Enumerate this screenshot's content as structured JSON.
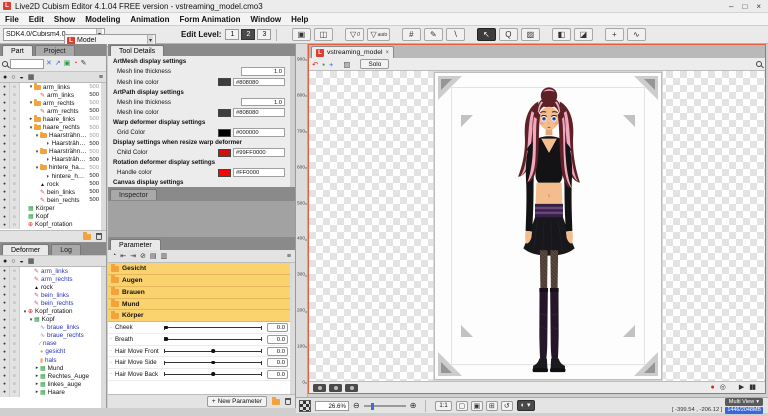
{
  "theme": {
    "accent-orange": "#e2613c",
    "folder-orange": "#f2a33c",
    "param-yellow": "#fad36e",
    "link-blue": "#2233bb",
    "hair-dark": "#5d2127",
    "hair-pink": "#f0a8bd",
    "skin": "#f3bd8d",
    "outfit": "#131315",
    "boot": "#251729",
    "eye-blue": "#3a66cc"
  },
  "icons": {
    "minimize": "–",
    "maximize": "□",
    "close": "×",
    "dropdown": "▾",
    "eye": "●",
    "lock": "○",
    "ghost": "◒",
    "grid": "▦",
    "menu": "≡",
    "tab-close": "×",
    "caret": "▾",
    "mag-minus": "⊖",
    "mag-plus": "⊕",
    "rotate": "↺",
    "grid-btn": "⊞",
    "display": "◐",
    "record": "●",
    "stop": "◎",
    "play": "▶",
    "pause": "▮▮",
    "new-param-plus": "+"
  },
  "title_bar": {
    "title": "Live2D Cubism Editor 4.1.04   FREE version - vstreaming_model.cmo3"
  },
  "menu_bar": {
    "items": [
      {
        "label": "File",
        "enabled": true
      },
      {
        "label": "Edit",
        "enabled": true
      },
      {
        "label": "Show",
        "enabled": true
      },
      {
        "label": "Modeling",
        "enabled": true
      },
      {
        "label": "Animation",
        "enabled": false
      },
      {
        "label": "Form Animation",
        "enabled": false
      },
      {
        "label": "Window",
        "enabled": true
      },
      {
        "label": "Help",
        "enabled": true
      }
    ]
  },
  "toolbar": {
    "sdk_value": "SDK4.0/Cubism4.0",
    "mode_value": "Model",
    "edit_level_label": "Edit Level:",
    "edit_levels": [
      {
        "label": "1",
        "active": false
      },
      {
        "label": "2",
        "active": true
      },
      {
        "label": "3",
        "active": false
      }
    ],
    "tool_buttons": [
      {
        "glyph": "▣"
      },
      {
        "glyph": "◫"
      },
      {
        "glyph": "▽",
        "sub": "0",
        "gap": true
      },
      {
        "glyph": "▽",
        "sub": "auto"
      },
      {
        "glyph": "#",
        "gap": true
      },
      {
        "glyph": "✎"
      },
      {
        "glyph": "∖"
      },
      {
        "glyph": "↖",
        "sel": true,
        "gap": true
      },
      {
        "glyph": "Q"
      },
      {
        "glyph": "▨"
      },
      {
        "glyph": "◧",
        "gap": true
      },
      {
        "glyph": "◪"
      },
      {
        "glyph": "+",
        "gap": true
      },
      {
        "glyph": "∿"
      }
    ]
  },
  "part_panel": {
    "tabs": [
      {
        "label": "Part",
        "active": true
      },
      {
        "label": "Project",
        "active": false
      }
    ],
    "quick_icons": [
      {
        "glyph": "✕",
        "color2": "#3a6fd8"
      },
      {
        "glyph": "↗",
        "color2": "#3a6fd8"
      },
      {
        "glyph": "▣",
        "color2": "#2a9c3f"
      },
      {
        "glyph": "◔",
        "color2": "#cc2222"
      },
      {
        "glyph": "✎",
        "color2": "#333333"
      }
    ],
    "rows": [
      {
        "label": "arm_links",
        "icon": "folder",
        "expand": "open",
        "indent": 1,
        "value": "500",
        "muted": true
      },
      {
        "label": "arm_links",
        "icon": "mesh",
        "expand": "none",
        "indent": 2,
        "value": "500"
      },
      {
        "label": "arm_rechts",
        "icon": "folder",
        "expand": "open",
        "indent": 1,
        "value": "500",
        "muted": true
      },
      {
        "label": "arm_rechts",
        "icon": "mesh",
        "expand": "none",
        "indent": 2,
        "value": "500"
      },
      {
        "label": "haare_links",
        "icon": "folder",
        "expand": "closed",
        "indent": 1,
        "value": "500",
        "muted": true
      },
      {
        "label": "haare_rechts",
        "icon": "folder",
        "expand": "open",
        "indent": 1,
        "value": "500",
        "muted": true
      },
      {
        "label": "Haarsträhne_rechts",
        "icon": "folder",
        "expand": "open",
        "indent": 2,
        "value": "500",
        "muted": true
      },
      {
        "label": "Haarsträhne_rechts",
        "icon": "hair",
        "expand": "none",
        "indent": 3,
        "value": "500"
      },
      {
        "label": "Haarsträhne_rechts",
        "icon": "folder",
        "expand": "open",
        "indent": 2,
        "value": "500",
        "muted": true
      },
      {
        "label": "Haarsträhne_rechts",
        "icon": "hair",
        "expand": "none",
        "indent": 3,
        "value": "500"
      },
      {
        "label": "hintere_haare_rechts",
        "icon": "folder",
        "expand": "open",
        "indent": 2,
        "value": "500",
        "muted": true
      },
      {
        "label": "hintere_haare",
        "icon": "hair",
        "expand": "none",
        "indent": 3,
        "value": "500"
      },
      {
        "label": "rock",
        "icon": "skirt",
        "expand": "none",
        "indent": 2,
        "value": "500"
      },
      {
        "label": "bein_links",
        "icon": "mesh",
        "expand": "none",
        "indent": 2,
        "value": "500"
      },
      {
        "label": "bein_rechts",
        "icon": "mesh",
        "expand": "none",
        "indent": 2,
        "value": "500"
      },
      {
        "label": "Körper",
        "icon": "warp",
        "expand": "none",
        "indent": 0,
        "value": ""
      },
      {
        "label": "Kopf",
        "icon": "warp",
        "expand": "none",
        "indent": 0,
        "value": ""
      },
      {
        "label": "Kopf_rotation",
        "icon": "rot",
        "expand": "none",
        "indent": 0,
        "value": ""
      }
    ]
  },
  "deformer_panel": {
    "tabs": [
      {
        "label": "Deformer",
        "active": true
      },
      {
        "label": "Log",
        "active": false
      }
    ],
    "rows": [
      {
        "label": "arm_links",
        "icon": "mesh",
        "expand": "none",
        "indent": 1,
        "color": "blue"
      },
      {
        "label": "arm_rechts",
        "icon": "mesh",
        "expand": "none",
        "indent": 1,
        "color": "blue"
      },
      {
        "label": "rock",
        "icon": "skirt",
        "expand": "none",
        "indent": 1,
        "color": "black"
      },
      {
        "label": "bein_links",
        "icon": "mesh",
        "expand": "none",
        "indent": 1,
        "color": "blue"
      },
      {
        "label": "bein_rechts",
        "icon": "mesh",
        "expand": "none",
        "indent": 1,
        "color": "blue"
      },
      {
        "label": "Kopf_rotation",
        "icon": "rot",
        "expand": "open",
        "indent": 0,
        "color": "black"
      },
      {
        "label": "Kopf",
        "icon": "warp",
        "expand": "open",
        "indent": 1,
        "color": "black"
      },
      {
        "label": "braue_links",
        "icon": "curve",
        "expand": "none",
        "indent": 2,
        "color": "blue"
      },
      {
        "label": "braue_rechts",
        "icon": "curve",
        "expand": "none",
        "indent": 2,
        "color": "blue"
      },
      {
        "label": "nase",
        "icon": "line",
        "expand": "none",
        "indent": 2,
        "color": "blue"
      },
      {
        "label": "gesicht",
        "icon": "dot-orange",
        "expand": "none",
        "indent": 2,
        "color": "blue"
      },
      {
        "label": "hals",
        "icon": "box-orange",
        "expand": "none",
        "indent": 2,
        "color": "blue"
      },
      {
        "label": "Mund",
        "icon": "warp",
        "expand": "closed",
        "indent": 2,
        "color": "black"
      },
      {
        "label": "Rechtes_Auge",
        "icon": "warp",
        "expand": "closed",
        "indent": 2,
        "color": "black"
      },
      {
        "label": "linkes_auge",
        "icon": "warp",
        "expand": "closed",
        "indent": 2,
        "color": "black"
      },
      {
        "label": "Haare",
        "icon": "warp",
        "expand": "closed",
        "indent": 2,
        "color": "black"
      }
    ]
  },
  "tool_details": {
    "tab": "Tool Details",
    "inspector_tab": "Inspector",
    "rows": [
      {
        "kind": "header",
        "label": "ArtMesh display settings"
      },
      {
        "kind": "field",
        "label": "Mesh line thickness",
        "value": "1.0",
        "input": "number"
      },
      {
        "kind": "field",
        "label": "Mesh line color",
        "value": "#808080",
        "swatch": "#3d3d3d",
        "input": "color"
      },
      {
        "kind": "header",
        "label": "ArtPath display settings"
      },
      {
        "kind": "field",
        "label": "Mesh line thickness",
        "value": "1.0",
        "input": "number"
      },
      {
        "kind": "field",
        "label": "Mesh line color",
        "value": "#808080",
        "swatch": "#3d3d3d",
        "input": "color"
      },
      {
        "kind": "header",
        "label": "Warp deformer display settings"
      },
      {
        "kind": "field",
        "label": "Grid Color",
        "value": "#000000",
        "swatch": "#000000",
        "input": "color"
      },
      {
        "kind": "header",
        "label": "Display settings when resize warp deformer"
      },
      {
        "kind": "field",
        "label": "Child Color",
        "value": "#99FF0000",
        "swatch": "#cc1111",
        "input": "color"
      },
      {
        "kind": "header",
        "label": "Rotation deformer display settings"
      },
      {
        "kind": "field",
        "label": "Handle color",
        "value": "#FF0000",
        "swatch": "#ff0000",
        "input": "color"
      },
      {
        "kind": "header",
        "label": "Canvas display settings"
      }
    ]
  },
  "parameter_panel": {
    "tab": "Parameter",
    "toolbar_icons": [
      {
        "glyph": "◔"
      },
      {
        "glyph": "⇤"
      },
      {
        "glyph": "⇥"
      },
      {
        "glyph": "⊘"
      },
      {
        "glyph": "▤"
      },
      {
        "glyph": "▥"
      }
    ],
    "folders": [
      {
        "label": "Gesicht"
      },
      {
        "label": "Augen"
      },
      {
        "label": "Brauen"
      },
      {
        "label": "Mund"
      },
      {
        "label": "Körper"
      }
    ],
    "sliders": [
      {
        "label": "Cheek",
        "value": "0.0",
        "pos": 0.02
      },
      {
        "label": "Breath",
        "value": "0.0",
        "pos": 0.02
      },
      {
        "label": "Hair Move Front",
        "value": "0.0",
        "pos": 0.5
      },
      {
        "label": "Hair Move Side",
        "value": "0.0",
        "pos": 0.5
      },
      {
        "label": "Hair Move Back",
        "value": "0.0",
        "pos": 0.5
      }
    ],
    "new_parameter_label": "New Parameter"
  },
  "ruler": {
    "ticks": [
      {
        "label": "900",
        "pos": 0.045
      },
      {
        "label": "800",
        "pos": 0.147
      },
      {
        "label": "700",
        "pos": 0.248
      },
      {
        "label": "600",
        "pos": 0.35
      },
      {
        "label": "500",
        "pos": 0.452
      },
      {
        "label": "400",
        "pos": 0.553
      },
      {
        "label": "300",
        "pos": 0.655
      },
      {
        "label": "200",
        "pos": 0.757
      },
      {
        "label": "100",
        "pos": 0.858
      },
      {
        "label": "0",
        "pos": 0.96
      }
    ]
  },
  "canvas": {
    "tab_label": "vstreaming_model",
    "solo_label": "Solo",
    "tool_icons": [
      {
        "glyph": "↶",
        "color2": "#cc3322"
      },
      {
        "glyph": "▪",
        "color2": "#2a9c3f"
      },
      {
        "glyph": "+",
        "color2": "#3a6fd8"
      },
      {
        "glyph": "▨",
        "color2": "#555555",
        "gap": true
      }
    ],
    "record_icons": [
      {
        "glyph": "●",
        "color2": "#d42222"
      },
      {
        "glyph": "◎",
        "color2": "#333333"
      },
      {
        "glyph": "▶",
        "color2": "#333333",
        "gap": true
      },
      {
        "glyph": "▮▮",
        "color2": "#333333"
      }
    ]
  },
  "status_bar": {
    "zoom_value": "26.6%",
    "one_to_one": "1:1",
    "view_buttons": [
      {
        "glyph": "▢"
      },
      {
        "glyph": "▣"
      },
      {
        "glyph": "⊞",
        "gap": true
      },
      {
        "glyph": "↺"
      }
    ],
    "multi_view_label": "Multi View",
    "coords": "[ -399.54 , -206.12 ]",
    "memory": "1446/2048MB"
  }
}
